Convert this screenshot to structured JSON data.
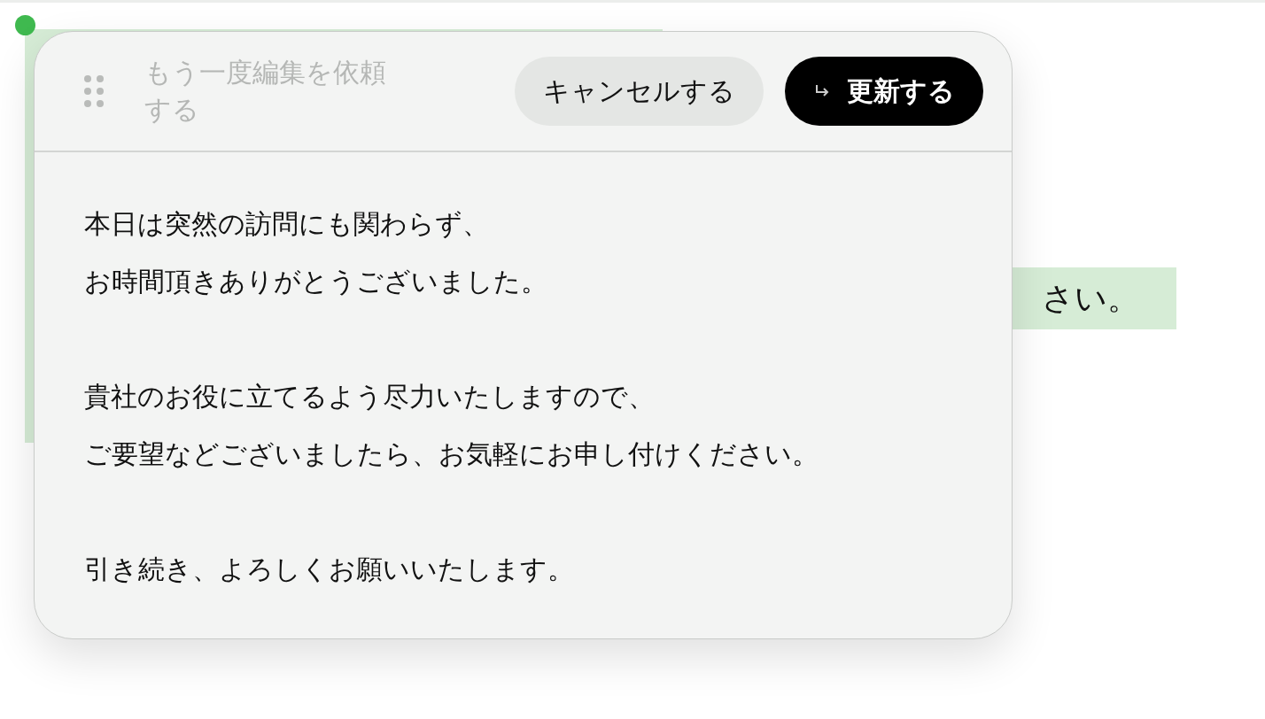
{
  "document": {
    "visible_text": "さい。"
  },
  "edit_panel": {
    "prompt": {
      "placeholder": "もう一度編集を依頼する"
    },
    "buttons": [
      {
        "kind": "secondary",
        "label": "キャンセルする"
      },
      {
        "kind": "primary",
        "label": "更新する"
      }
    ],
    "paragraphs": [
      [
        "本日は突然の訪問にも関わらず、",
        "お時間頂きありがとうございました。"
      ],
      [
        "貴社のお役に立てるよう尽力いたしますので、",
        "ご要望などございましたら、お気軽にお申し付けください。"
      ],
      [
        "引き続き、よろしくお願いいたします。"
      ]
    ]
  }
}
